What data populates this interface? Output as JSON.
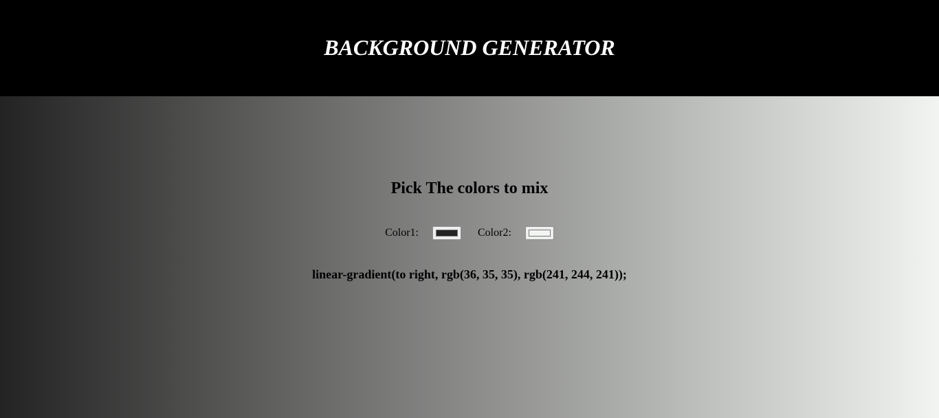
{
  "header": {
    "title": "BACKGROUND GENERATOR",
    "background": "#000000",
    "text_color": "#ffffff"
  },
  "main": {
    "heading": "Pick The colors to mix",
    "color1": {
      "label": "Color1:",
      "value": "#242323"
    },
    "color2": {
      "label": "Color2:",
      "value": "#f1f4f1"
    },
    "css_output": "linear-gradient(to right, rgb(36, 35, 35), rgb(241, 244, 241));"
  }
}
